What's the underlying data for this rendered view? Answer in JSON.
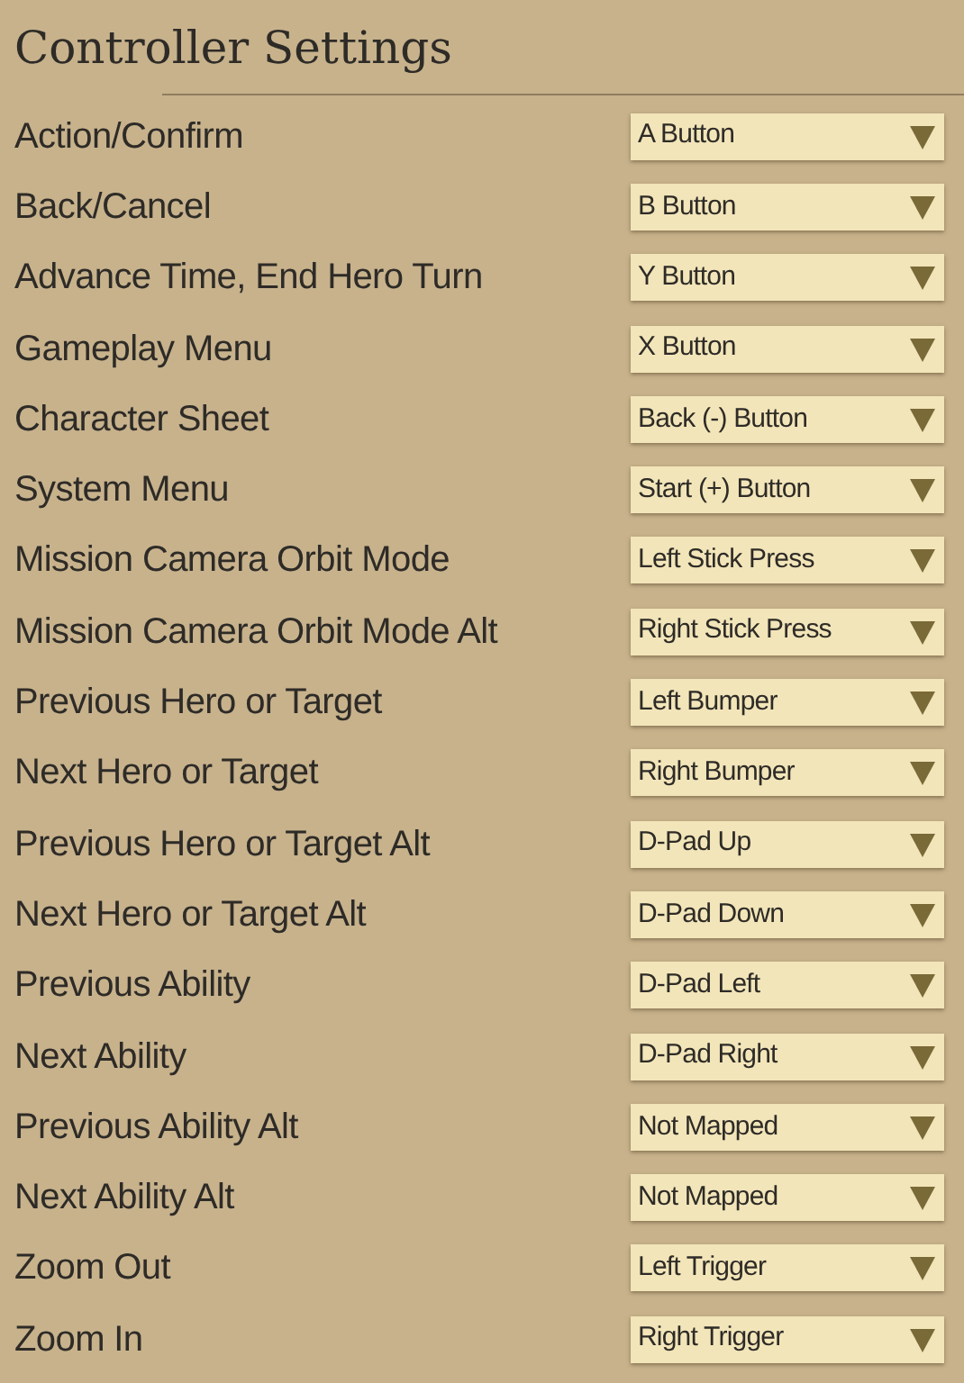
{
  "title": "Controller Settings",
  "bindings": [
    {
      "action": "Action/Confirm",
      "button": "A Button"
    },
    {
      "action": "Back/Cancel",
      "button": "B Button"
    },
    {
      "action": "Advance Time, End Hero Turn",
      "button": "Y Button"
    },
    {
      "action": "Gameplay Menu",
      "button": "X Button"
    },
    {
      "action": "Character Sheet",
      "button": "Back (-) Button"
    },
    {
      "action": "System Menu",
      "button": "Start (+) Button"
    },
    {
      "action": "Mission Camera Orbit Mode",
      "button": "Left Stick Press"
    },
    {
      "action": "Mission Camera Orbit Mode Alt",
      "button": "Right Stick Press"
    },
    {
      "action": "Previous Hero or Target",
      "button": "Left Bumper"
    },
    {
      "action": "Next Hero or Target",
      "button": "Right Bumper"
    },
    {
      "action": "Previous Hero or Target Alt",
      "button": "D-Pad Up"
    },
    {
      "action": "Next Hero or Target Alt",
      "button": "D-Pad Down"
    },
    {
      "action": "Previous Ability",
      "button": "D-Pad Left"
    },
    {
      "action": "Next Ability",
      "button": "D-Pad Right"
    },
    {
      "action": "Previous Ability Alt",
      "button": "Not Mapped"
    },
    {
      "action": "Next Ability Alt",
      "button": "Not Mapped"
    },
    {
      "action": "Zoom Out",
      "button": "Left Trigger"
    },
    {
      "action": "Zoom In",
      "button": "Right Trigger"
    }
  ]
}
